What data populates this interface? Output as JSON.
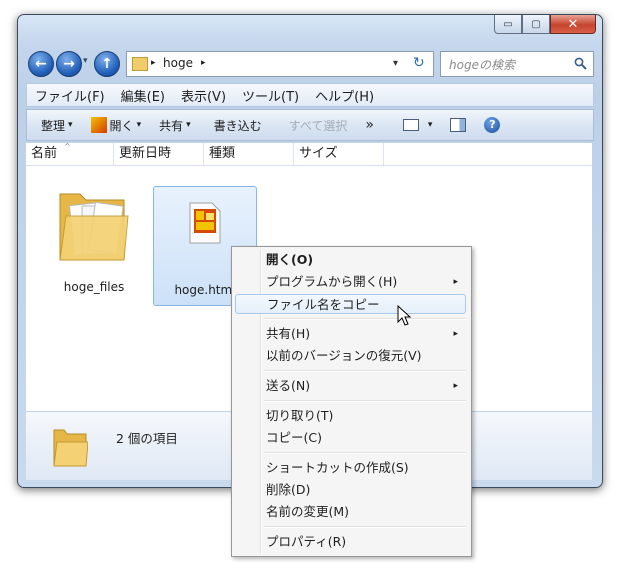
{
  "window": {
    "minimize": "▭",
    "maximize": "▢",
    "close": "✕"
  },
  "nav": {
    "breadcrumb_sep1": "▸",
    "folder_name": "hoge",
    "breadcrumb_sep2": "▸",
    "dropdown": "▾",
    "refresh": "↻",
    "search_placeholder": "hogeの検索"
  },
  "menubar": {
    "items": [
      "ファイル(F)",
      "編集(E)",
      "表示(V)",
      "ツール(T)",
      "ヘルプ(H)"
    ]
  },
  "commandbar": {
    "organize": "整理",
    "open": "開く",
    "share": "共有",
    "burn": "書き込む",
    "select_all": "すべて選択",
    "more": "»"
  },
  "columns": {
    "name": "名前",
    "date": "更新日時",
    "type": "種類",
    "size": "サイズ"
  },
  "files": [
    {
      "name": "hoge_files"
    },
    {
      "name": "hoge.html"
    }
  ],
  "details": {
    "count": "2 個の項目"
  },
  "context_menu": {
    "items": [
      "開く(O)",
      "プログラムから開く(H)",
      "ファイル名をコピー",
      "共有(H)",
      "以前のバージョンの復元(V)",
      "送る(N)",
      "切り取り(T)",
      "コピー(C)",
      "ショートカットの作成(S)",
      "削除(D)",
      "名前の変更(M)",
      "プロパティ(R)"
    ],
    "submenu_arrow": "▸"
  },
  "colors": {
    "window_frame": "#c4d6ec",
    "selection": "#cce1f8",
    "folder": "#f0c75e"
  }
}
